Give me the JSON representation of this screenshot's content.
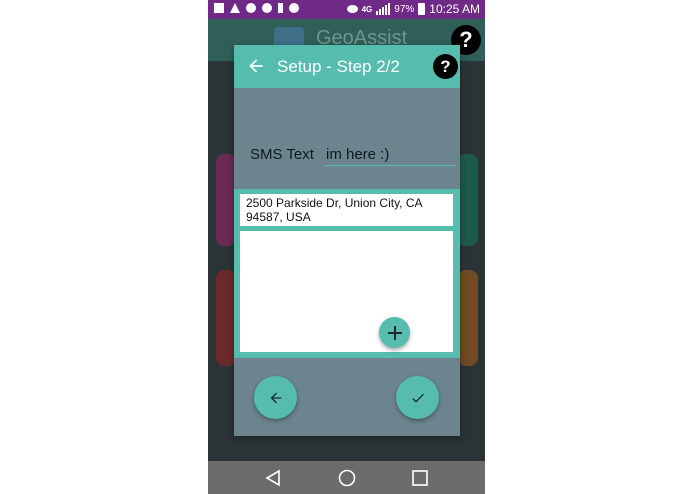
{
  "status_bar": {
    "time": "10:25 AM",
    "battery": "97%",
    "network": "4G",
    "icons": [
      "image-icon",
      "volume-icon",
      "wifi-icon",
      "chrome-icon",
      "usb-icon",
      "android-icon"
    ]
  },
  "background_app": {
    "title": "GeoAssist",
    "help_label": "?"
  },
  "dialog": {
    "title": "Setup - Step 2/2",
    "help_label": "?",
    "sms_label": "SMS Text",
    "sms_value": "im here :)",
    "address": "2500 Parkside Dr, Union City, CA 94587, USA"
  },
  "colors": {
    "accent": "#55bcae",
    "status_bar": "#6f2a86",
    "dialog_bg": "#6c848e"
  }
}
